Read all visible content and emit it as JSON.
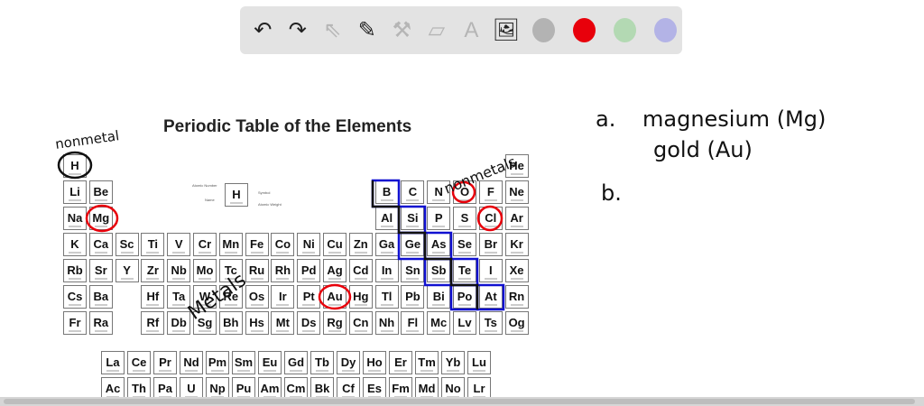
{
  "toolbar": {
    "tools": [
      {
        "icon": "undo-icon",
        "glyph": "↶",
        "enabled": true
      },
      {
        "icon": "redo-icon",
        "glyph": "↷",
        "enabled": true
      },
      {
        "icon": "select-pointer-icon",
        "glyph": "⇖",
        "enabled": false
      },
      {
        "icon": "pen-icon",
        "glyph": "✎",
        "enabled": true
      },
      {
        "icon": "tools-icon",
        "glyph": "⚒",
        "enabled": false
      },
      {
        "icon": "eraser-icon",
        "glyph": "▱",
        "enabled": false
      },
      {
        "icon": "text-icon",
        "glyph": "A",
        "enabled": false
      },
      {
        "icon": "image-icon",
        "glyph": "🖼",
        "enabled": true
      }
    ],
    "colors": [
      "#b3b3b3",
      "#e8000b",
      "#b3d9b3",
      "#b3b3e6"
    ]
  },
  "table": {
    "title": "Periodic Table of the Elements",
    "legend": {
      "symbol": "H",
      "atomic_number_label": "Atomic Number",
      "name_label": "Name",
      "symbol_label": "Symbol",
      "weight_label": "Atomic Weight"
    },
    "main": [
      [
        "H",
        "",
        "",
        "",
        "",
        "",
        "",
        "",
        "",
        "",
        "",
        "",
        "",
        "",
        "",
        "",
        "",
        "He"
      ],
      [
        "Li",
        "Be",
        "",
        "",
        "",
        "",
        "",
        "",
        "",
        "",
        "",
        "",
        "B",
        "C",
        "N",
        "O",
        "F",
        "Ne"
      ],
      [
        "Na",
        "Mg",
        "",
        "",
        "",
        "",
        "",
        "",
        "",
        "",
        "",
        "",
        "Al",
        "Si",
        "P",
        "S",
        "Cl",
        "Ar"
      ],
      [
        "K",
        "Ca",
        "Sc",
        "Ti",
        "V",
        "Cr",
        "Mn",
        "Fe",
        "Co",
        "Ni",
        "Cu",
        "Zn",
        "Ga",
        "Ge",
        "As",
        "Se",
        "Br",
        "Kr"
      ],
      [
        "Rb",
        "Sr",
        "Y",
        "Zr",
        "Nb",
        "Mo",
        "Tc",
        "Ru",
        "Rh",
        "Pd",
        "Ag",
        "Cd",
        "In",
        "Sn",
        "Sb",
        "Te",
        "I",
        "Xe"
      ],
      [
        "Cs",
        "Ba",
        "",
        "Hf",
        "Ta",
        "W",
        "Re",
        "Os",
        "Ir",
        "Pt",
        "Au",
        "Hg",
        "Tl",
        "Pb",
        "Bi",
        "Po",
        "At",
        "Rn"
      ],
      [
        "Fr",
        "Ra",
        "",
        "Rf",
        "Db",
        "Sg",
        "Bh",
        "Hs",
        "Mt",
        "Ds",
        "Rg",
        "Cn",
        "Nh",
        "Fl",
        "Mc",
        "Lv",
        "Ts",
        "Og"
      ]
    ],
    "lanthanides": [
      "La",
      "Ce",
      "Pr",
      "Nd",
      "Pm",
      "Sm",
      "Eu",
      "Gd",
      "Tb",
      "Dy",
      "Ho",
      "Er",
      "Tm",
      "Yb",
      "Lu"
    ],
    "actinides": [
      "Ac",
      "Th",
      "Pa",
      "U",
      "Np",
      "Pu",
      "Am",
      "Cm",
      "Bk",
      "Cf",
      "Es",
      "Fm",
      "Md",
      "No",
      "Lr"
    ]
  },
  "annotations": {
    "nonmetal": "nonmetal",
    "nonmetals": "nonmetals",
    "metals": "Metals",
    "answer_a_label": "a.",
    "answer_a_line1": "magnesium (Mg)",
    "answer_a_line2": "gold (Au)",
    "answer_b_label": "b.",
    "ink_black": "#111111",
    "ink_red": "#e8000b",
    "ink_blue": "#1010d0"
  }
}
